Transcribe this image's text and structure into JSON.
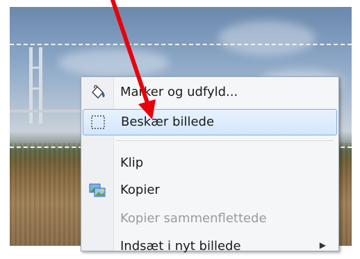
{
  "menu": {
    "items": [
      {
        "label": "Marker og udfyld...",
        "icon": "paint-bucket-icon",
        "state": "normal"
      },
      {
        "label": "Beskær billede",
        "icon": "crop-selection-icon",
        "state": "highlighted"
      },
      {
        "label": "Klip",
        "icon": "",
        "state": "normal"
      },
      {
        "label": "Kopier",
        "icon": "copy-image-icon",
        "state": "normal"
      },
      {
        "label": "Kopier sammenflettede",
        "icon": "",
        "state": "disabled"
      },
      {
        "label": "Indsæt i nyt billede",
        "icon": "",
        "state": "normal",
        "submenu": true
      }
    ]
  },
  "colors": {
    "highlight_border": "#84acdd",
    "highlight_fill": "#d3e7fb",
    "annotation_arrow": "#e8000b",
    "selection_marquee": "#f4f4f4"
  }
}
